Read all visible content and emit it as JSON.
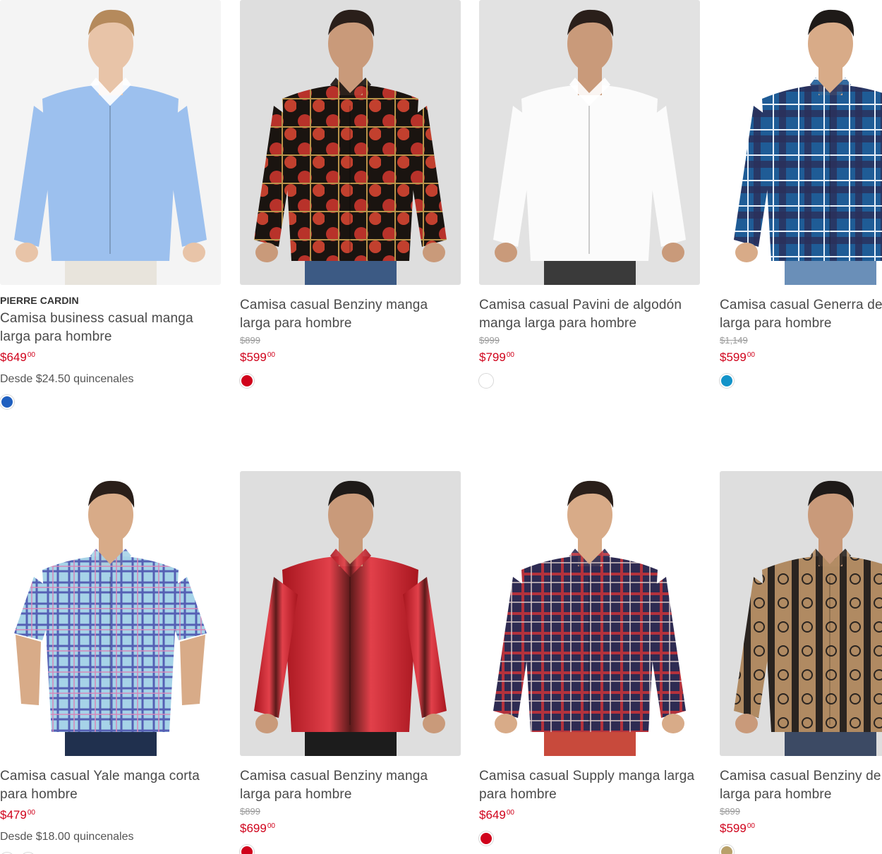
{
  "products": [
    {
      "brand": "PIERRE CARDIN",
      "title": "Camisa business casual manga larga para hombre",
      "old_price": "",
      "price": "$649",
      "price_cents": "00",
      "installments": "Desde $24.50 quincenales",
      "swatches": [
        "#1f5fbf"
      ]
    },
    {
      "brand": "",
      "title": "Camisa casual Benziny manga larga para hombre",
      "old_price": "$899",
      "price": "$599",
      "price_cents": "00",
      "installments": "",
      "swatches": [
        "#d0021b"
      ]
    },
    {
      "brand": "",
      "title": "Camisa casual Pavini de algodón manga larga para hombre",
      "old_price": "$999",
      "price": "$799",
      "price_cents": "00",
      "installments": "",
      "swatches": [
        "#ffffff"
      ]
    },
    {
      "brand": "",
      "title": "Camisa casual Generra de a manga larga para hombre",
      "old_price": "$1,149",
      "price": "$599",
      "price_cents": "00",
      "installments": "",
      "swatches": [
        "#1393c9"
      ]
    },
    {
      "brand": "",
      "title": "Camisa casual Yale manga corta para hombre",
      "old_price": "",
      "price": "$479",
      "price_cents": "00",
      "installments": "Desde $18.00 quincenales",
      "swatches": [
        "#1393c9",
        "#f08080"
      ]
    },
    {
      "brand": "",
      "title": "Camisa casual Benziny manga larga para hombre",
      "old_price": "$899",
      "price": "$699",
      "price_cents": "00",
      "installments": "",
      "swatches": [
        "#d0021b"
      ]
    },
    {
      "brand": "",
      "title": "Camisa casual Supply manga larga para hombre",
      "old_price": "",
      "price": "$649",
      "price_cents": "00",
      "installments": "",
      "swatches": [
        "#d0021b"
      ]
    },
    {
      "brand": "",
      "title": "Camisa casual Benziny de a manga larga para hombre",
      "old_price": "$899",
      "price": "$599",
      "price_cents": "00",
      "installments": "",
      "swatches": [
        "#b8a06a"
      ]
    }
  ]
}
